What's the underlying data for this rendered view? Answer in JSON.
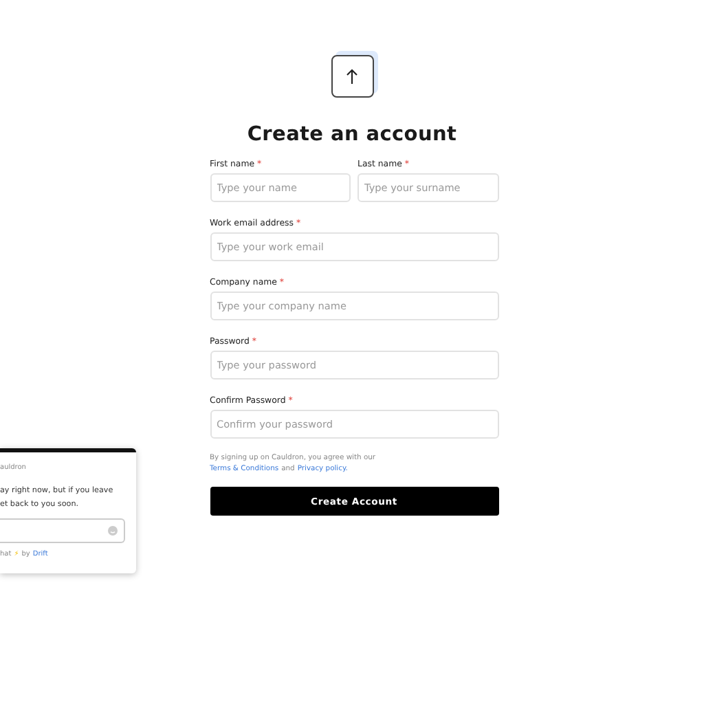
{
  "title": "Create an account",
  "name_fields": [
    {
      "label": "First name",
      "required_mark": "*",
      "placeholder": "Type your name"
    },
    {
      "label": "Last name",
      "required_mark": "*",
      "placeholder": "Type your surname"
    }
  ],
  "fields": [
    {
      "label": "Work email address",
      "required_mark": "*",
      "placeholder": "Type your work email"
    },
    {
      "label": "Company name",
      "required_mark": "*",
      "placeholder": "Type your company name"
    },
    {
      "label": "Password",
      "required_mark": "*",
      "placeholder": "Type your password"
    },
    {
      "label": "Confirm Password",
      "required_mark": "*",
      "placeholder": "Confirm your password"
    }
  ],
  "terms": {
    "text": "By signing up on Cauldron, you agree with our",
    "link_1": "Terms & Conditions",
    "joiner": "and",
    "link_2": "Privacy policy."
  },
  "submit_button": "Create Account",
  "chat_widget": {
    "brand": "auldron",
    "message_line_1": "ay right now, but if you leave",
    "message_line_2": "et back to you soon.",
    "footer_start": "hat",
    "footer_icon": "⚡",
    "footer_by": "by",
    "footer_link": "Drift"
  }
}
